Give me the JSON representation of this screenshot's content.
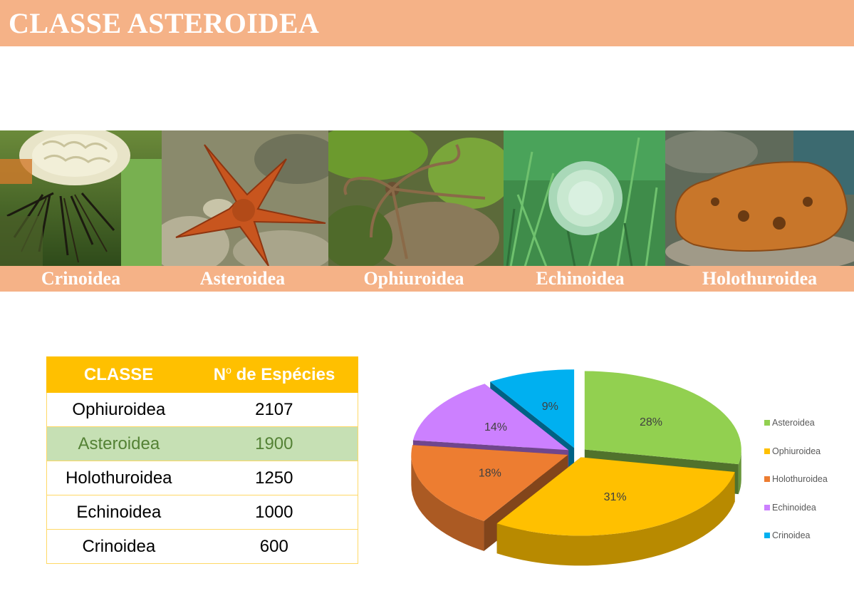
{
  "title": "CLASSE ASTEROIDEA",
  "photos": [
    {
      "label": "Crinoidea",
      "subject": "feather-star"
    },
    {
      "label": "Asteroidea",
      "subject": "sea-star"
    },
    {
      "label": "Ophiuroidea",
      "subject": "brittle-star"
    },
    {
      "label": "Echinoidea",
      "subject": "sea-urchin"
    },
    {
      "label": "Holothuroidea",
      "subject": "sea-cucumber"
    }
  ],
  "table": {
    "headers": [
      "CLASSE",
      "Nº de Espécies"
    ],
    "header_super": "o",
    "rows": [
      {
        "classe": "Ophiuroidea",
        "especies": "2107",
        "highlight": false
      },
      {
        "classe": "Asteroidea",
        "especies": "1900",
        "highlight": true
      },
      {
        "classe": "Holothuroidea",
        "especies": "1250",
        "highlight": false
      },
      {
        "classe": "Echinoidea",
        "especies": "1000",
        "highlight": false
      },
      {
        "classe": "Crinoidea",
        "especies": "600",
        "highlight": false
      }
    ],
    "header_color": "#ffc000",
    "highlight_color": "#c6e0b4"
  },
  "chart_data": {
    "type": "pie",
    "style": "3d-exploded",
    "slices": [
      {
        "label": "Asteroidea",
        "percent": 28,
        "value": 1900,
        "color": "#92d050"
      },
      {
        "label": "Ophiuroidea",
        "percent": 31,
        "value": 2107,
        "color": "#ffc000"
      },
      {
        "label": "Holothuroidea",
        "percent": 18,
        "value": 1250,
        "color": "#ed7d31"
      },
      {
        "label": "Echinoidea",
        "percent": 14,
        "value": 1000,
        "color": "#cc80ff"
      },
      {
        "label": "Crinoidea",
        "percent": 9,
        "value": 600,
        "color": "#00b0f0"
      }
    ],
    "legend_position": "right",
    "data_labels": [
      "28%",
      "31%",
      "18%",
      "14%",
      "9%"
    ]
  }
}
